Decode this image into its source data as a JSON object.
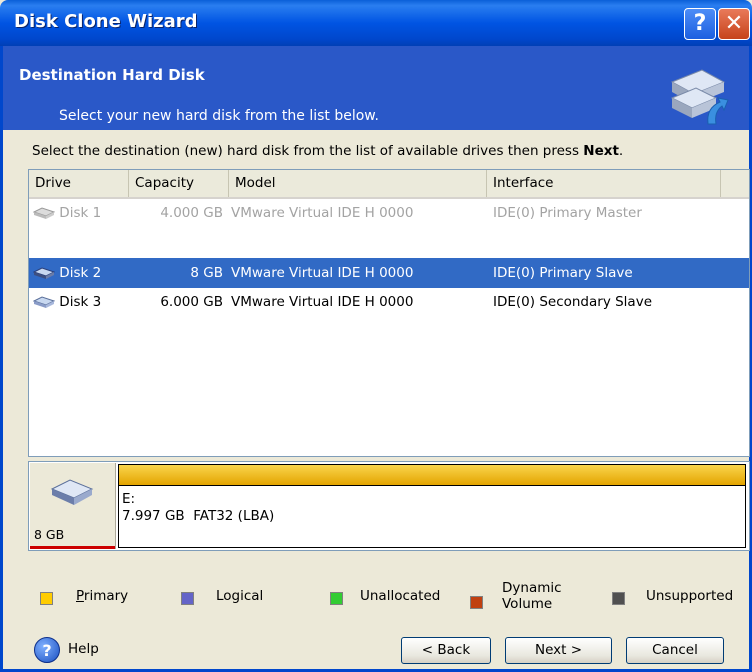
{
  "window": {
    "title": "Disk Clone Wizard",
    "help_glyph": "?",
    "close_glyph": "✕"
  },
  "header": {
    "title": "Destination Hard Disk",
    "subtitle": "Select your new hard disk from the list below.",
    "icon": "disk-clone-icon"
  },
  "instruction": {
    "text": "Select the destination (new) hard disk from the list of available drives then press ",
    "bold": "Next",
    "end": "."
  },
  "list": {
    "columns": [
      "Drive",
      "Capacity",
      "Model",
      "Interface"
    ],
    "rows": [
      {
        "drive": "Disk 1",
        "capacity": "4.000 GB",
        "model": "VMware Virtual IDE H 0000",
        "interface": "IDE(0) Primary Master",
        "state": "disabled"
      },
      {
        "drive": "Disk 2",
        "capacity": "8 GB",
        "model": "VMware Virtual IDE H 0000",
        "interface": "IDE(0) Primary Slave",
        "state": "selected"
      },
      {
        "drive": "Disk 3",
        "capacity": "6.000 GB",
        "model": "VMware Virtual IDE H 0000",
        "interface": "IDE(0) Secondary Slave",
        "state": "normal"
      }
    ]
  },
  "disk_map": {
    "size": "8 GB",
    "partition": {
      "letter": "E:",
      "detail": "7.997 GB  FAT32 (LBA)"
    }
  },
  "legend": [
    {
      "label": "Primary",
      "color": "#ffcc00"
    },
    {
      "label": "Logical",
      "color": "#6464c8"
    },
    {
      "label": "Unallocated",
      "color": "#33cc33"
    },
    {
      "label_line1": "Dynamic",
      "label_line2": "Volume",
      "color": "#c04010"
    },
    {
      "label": "Unsupported",
      "color": "#505050"
    }
  ],
  "footer": {
    "help": "Help",
    "back": "< Back",
    "next": "Next >",
    "cancel": "Cancel"
  },
  "colors": {
    "titlebar": "#0054e3",
    "header": "#2a58c8",
    "selection": "#316ac5"
  }
}
